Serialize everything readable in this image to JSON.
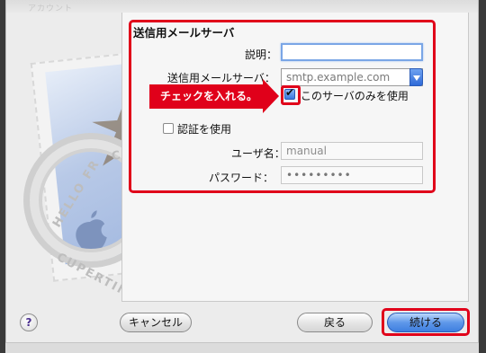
{
  "window": {
    "ghost_title": "アカウント"
  },
  "stamp": {
    "postmark_hello": "HELLO FR",
    "postmark_city_fragment": "CA",
    "postmark_cupertino": "CUPERTINO"
  },
  "form": {
    "section_title": "送信用メールサーバ",
    "description_label": "説明：",
    "description_value": "",
    "server_label": "送信用メールサーバ：",
    "server_value": "smtp.example.com",
    "use_only_label": "このサーバのみを使用",
    "use_only_checked": true,
    "auth_label": "認証を使用",
    "auth_checked": false,
    "username_label": "ユーザ名：",
    "username_value": "manual",
    "password_label": "パスワード：",
    "password_value": "•••••••••"
  },
  "annotation": {
    "callout_text": "チェックを入れる。",
    "color": "#e0001a"
  },
  "buttons": {
    "help": "?",
    "cancel": "キャンセル",
    "back": "戻る",
    "next": "続ける"
  },
  "colors": {
    "accent_blue": "#3f7fe0",
    "highlight_red": "#e0001a"
  }
}
